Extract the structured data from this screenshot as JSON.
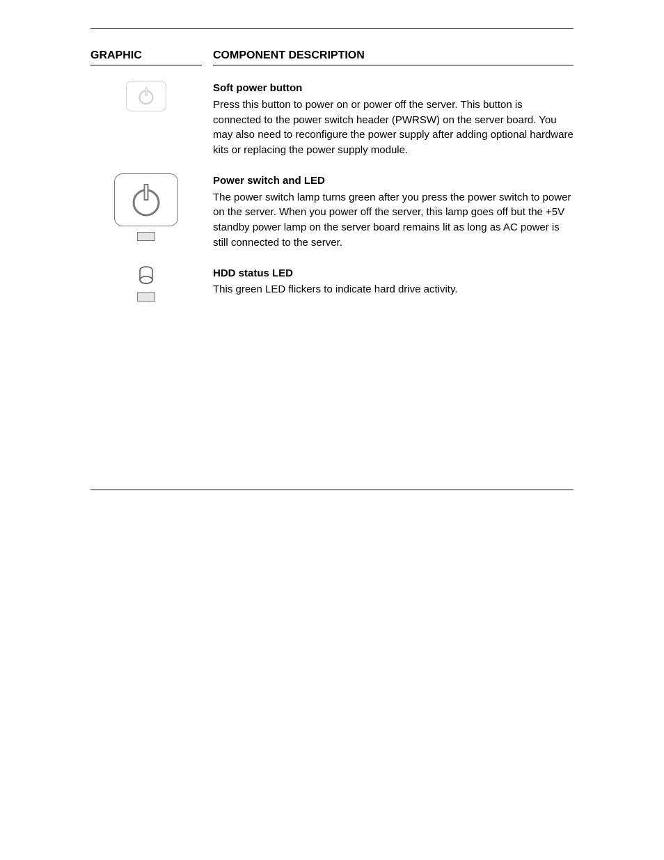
{
  "header": {
    "col_graphic": "GRAPHIC",
    "col_description": "COMPONENT DESCRIPTION"
  },
  "rows": [
    {
      "title": "Soft power button",
      "text": "Press this button to power on or power off the server. This button is connected to the power switch header (PWRSW) on the server board.\nYou may also need to reconfigure the power supply after adding optional hardware kits or replacing the power supply module."
    },
    {
      "title": "Power switch and LED",
      "text": "The power switch lamp turns green after you press the power switch to power on the server.\nWhen you power off the server, this lamp goes off but the +5V standby power lamp on the server board remains lit as long as AC power is still connected to the server."
    },
    {
      "title": "HDD status LED",
      "text": "This green LED flickers to indicate hard drive activity."
    }
  ]
}
